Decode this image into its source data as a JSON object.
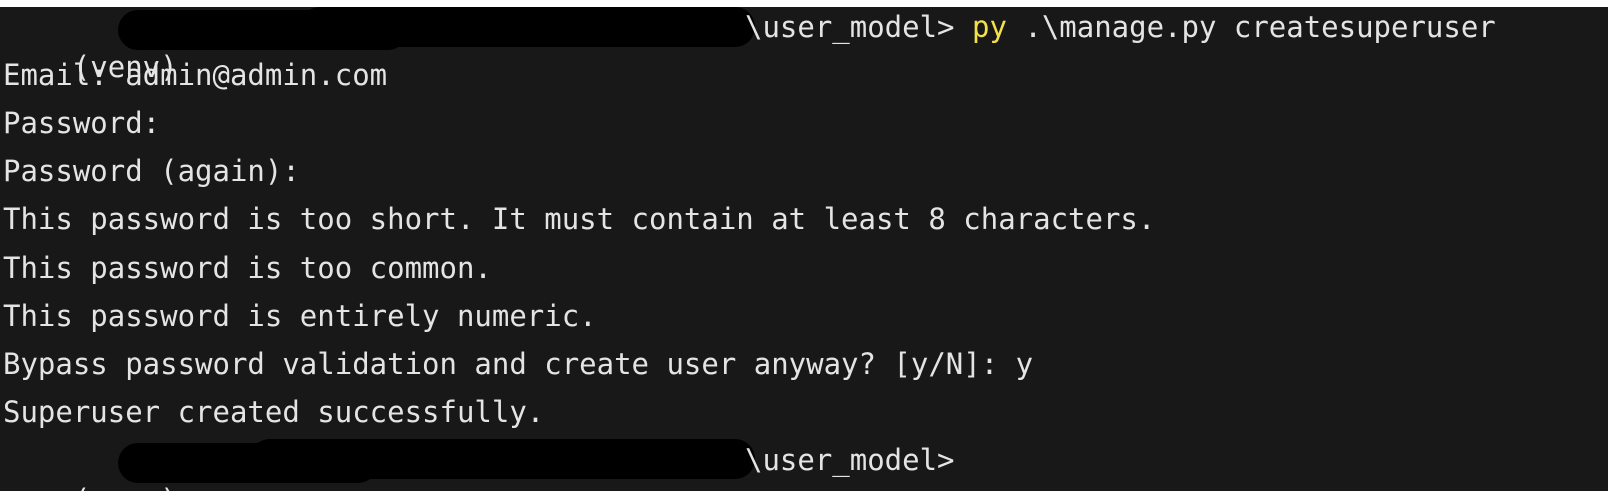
{
  "terminal": {
    "prompt_line_1": {
      "venv": "(venv) ",
      "path_suffix": "\\user_model>",
      "command_exe": "py",
      "command_args": " .\\manage.py createsuperuser"
    },
    "output_lines": [
      "Email: admin@admin.com",
      "Password:",
      "Password (again):",
      "This password is too short. It must contain at least 8 characters.",
      "This password is too common.",
      "This password is entirely numeric.",
      "Bypass password validation and create user anyway? [y/N]: y",
      "Superuser created successfully."
    ],
    "prompt_line_2": {
      "venv": "(venv) ",
      "path_suffix": "\\user_model>"
    }
  },
  "colors": {
    "background": "#181818",
    "text": "#e4e4e4",
    "command_highlight": "#f2e14a",
    "redaction": "#000000"
  }
}
